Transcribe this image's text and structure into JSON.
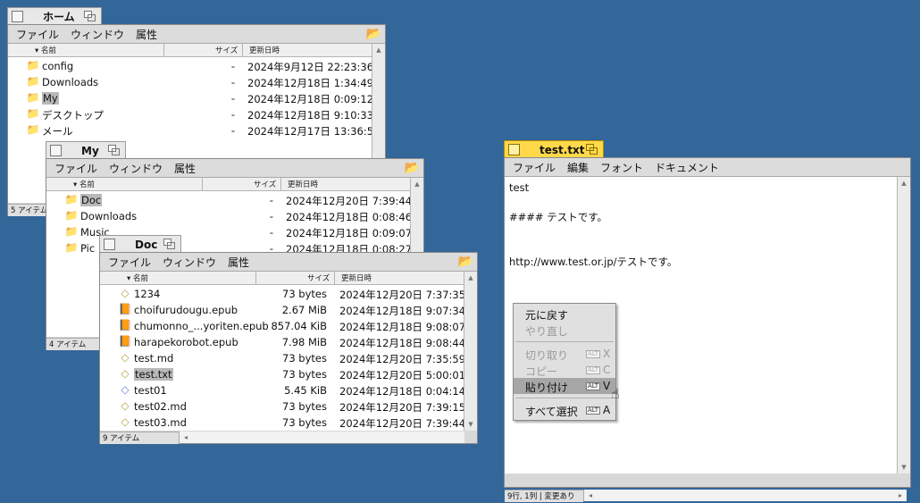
{
  "home_window": {
    "title": "ホーム",
    "menu": [
      "ファイル",
      "ウィンドウ",
      "属性"
    ],
    "columns": {
      "name": "名前",
      "size": "サイズ",
      "modified": "更新日時"
    },
    "rows": [
      {
        "icon": "folder-config-icon",
        "name": "config",
        "size": "-",
        "modified": "2024年9月12日 22:23:36"
      },
      {
        "icon": "folder-icon",
        "name": "Downloads",
        "size": "-",
        "modified": "2024年12月18日 1:34:49"
      },
      {
        "icon": "folder-icon",
        "name": "My",
        "size": "-",
        "modified": "2024年12月18日 0:09:12",
        "selected": true
      },
      {
        "icon": "desktop-folder-icon",
        "name": "デスクトップ",
        "size": "-",
        "modified": "2024年12月18日 9:10:33"
      },
      {
        "icon": "mail-folder-icon",
        "name": "メール",
        "size": "-",
        "modified": "2024年12月17日 13:36:57"
      }
    ],
    "status": "5 アイテム"
  },
  "my_window": {
    "title": "My",
    "menu": [
      "ファイル",
      "ウィンドウ",
      "属性"
    ],
    "columns": {
      "name": "名前",
      "size": "サイズ",
      "modified": "更新日時"
    },
    "rows": [
      {
        "icon": "folder-icon",
        "name": "Doc",
        "size": "-",
        "modified": "2024年12月20日 7:39:44",
        "selected": true
      },
      {
        "icon": "folder-icon",
        "name": "Downloads",
        "size": "-",
        "modified": "2024年12月18日 0:08:46"
      },
      {
        "icon": "folder-icon",
        "name": "Music",
        "size": "-",
        "modified": "2024年12月18日 0:09:07"
      },
      {
        "icon": "folder-icon",
        "name": "Pic",
        "size": "-",
        "modified": "2024年12月18日 0:08:27"
      }
    ],
    "status": "4 アイテム"
  },
  "doc_window": {
    "title": "Doc",
    "menu": [
      "ファイル",
      "ウィンドウ",
      "属性"
    ],
    "columns": {
      "name": "名前",
      "size": "サイズ",
      "modified": "更新日時"
    },
    "rows": [
      {
        "icon": "text-file-icon",
        "name": "1234",
        "size": "73 bytes",
        "modified": "2024年12月20日 7:37:35"
      },
      {
        "icon": "epub-icon",
        "name": "choifurudougu.epub",
        "size": "2.67 MiB",
        "modified": "2024年12月18日 9:07:34"
      },
      {
        "icon": "epub-icon",
        "name": "chumonno_...yoriten.epub",
        "size": "857.04 KiB",
        "modified": "2024年12月18日 9:08:07"
      },
      {
        "icon": "epub-icon",
        "name": "harapekorobot.epub",
        "size": "7.98 MiB",
        "modified": "2024年12月18日 9:08:44"
      },
      {
        "icon": "text-file-icon",
        "name": "test.md",
        "size": "73 bytes",
        "modified": "2024年12月20日 7:35:59"
      },
      {
        "icon": "text-file-icon",
        "name": "test.txt",
        "size": "73 bytes",
        "modified": "2024年12月20日 5:00:01",
        "selected": true
      },
      {
        "icon": "generic-file-icon",
        "name": "test01",
        "size": "5.45 KiB",
        "modified": "2024年12月18日 0:04:14"
      },
      {
        "icon": "text-file-icon",
        "name": "test02.md",
        "size": "73 bytes",
        "modified": "2024年12月20日 7:39:15"
      },
      {
        "icon": "text-file-icon",
        "name": "test03.md",
        "size": "73 bytes",
        "modified": "2024年12月20日 7:39:44"
      }
    ],
    "status": "9 アイテム"
  },
  "editor_window": {
    "title": "test.txt",
    "menu": [
      "ファイル",
      "編集",
      "フォント",
      "ドキュメント"
    ],
    "lines": [
      "test",
      "",
      "#### テストです。",
      "",
      "",
      "http://www.test.or.jp/テストです。"
    ],
    "status": "9行, 1列 | 変更あり"
  },
  "context_menu": {
    "items": [
      {
        "label": "元に戻す",
        "enabled": true
      },
      {
        "label": "やり直し",
        "enabled": false
      },
      {
        "label": "切り取り",
        "shortcut": "X",
        "alt": "ALT",
        "enabled": false
      },
      {
        "label": "コピー",
        "shortcut": "C",
        "alt": "ALT",
        "enabled": false
      },
      {
        "label": "貼り付け",
        "shortcut": "V",
        "alt": "ALT",
        "enabled": true,
        "highlighted": true
      },
      {
        "label": "すべて選択",
        "shortcut": "A",
        "alt": "ALT",
        "enabled": true
      }
    ]
  },
  "colors": {
    "desktop": "#336699",
    "active_tab": "#ffd94a",
    "selection": "#b9b9b9"
  }
}
